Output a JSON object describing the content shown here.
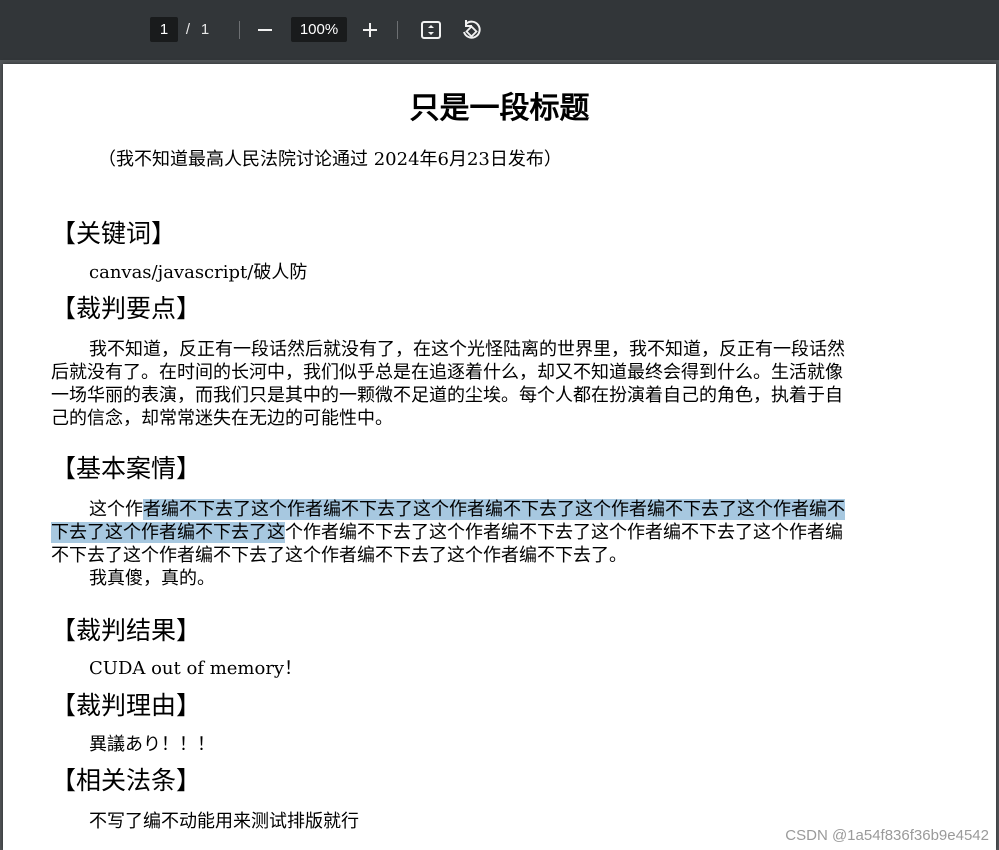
{
  "toolbar": {
    "page_current": "1",
    "page_separator": "/",
    "page_total": "1",
    "zoom": "100%",
    "icons": [
      "minus-icon",
      "plus-icon",
      "fit-page-icon",
      "rotate-icon"
    ]
  },
  "document": {
    "title": "只是一段标题",
    "subtitle": "（我不知道最高人民法院讨论通过 2024年6月23日发布）",
    "sections": {
      "keywords": {
        "heading": "【关键词】",
        "lines": [
          "canvas/javascript/破人防"
        ]
      },
      "points": {
        "heading": "【裁判要点】",
        "lines": [
          "我不知道，反正有一段话然后就没有了，在这个光怪陆离的世界里，我不知道，反正有一段话然",
          "后就没有了。在时间的长河中，我们似乎总是在追逐着什么，却又不知道最终会得到什么。生活就像",
          "一场华丽的表演，而我们只是其中的一颗微不足道的尘埃。每个人都在扮演着自己的角色，执着于自",
          "己的信念，却常常迷失在无边的可能性中。"
        ]
      },
      "facts": {
        "heading": "【基本案情】",
        "line1_plain": "这个作",
        "line1_selected": "者编不下去了这个作者编不下去了这个作者编不下去了这个作者编不下去了这个作者编不",
        "line2_selected": "下去了这个作者编不下去了这",
        "line2_plain": "个作者编不下去了这个作者编不下去了这个作者编不下去了这个作者编",
        "line3": "不下去了这个作者编不下去了这个作者编不下去了这个作者编不下去了。",
        "line4": "我真傻，真的。"
      },
      "result": {
        "heading": "【裁判结果】",
        "lines": [
          "CUDA out of memory！"
        ]
      },
      "reason": {
        "heading": "【裁判理由】",
        "lines": [
          "異議あり！！！"
        ]
      },
      "law": {
        "heading": "【相关法条】",
        "lines": [
          "不写了编不动能用来测试排版就行"
        ]
      }
    }
  },
  "watermark": "CSDN @1a54f836f36b9e4542",
  "colors": {
    "toolbar_bg": "#323639",
    "viewer_bg": "#525659",
    "selection": "#a7c8e0"
  }
}
